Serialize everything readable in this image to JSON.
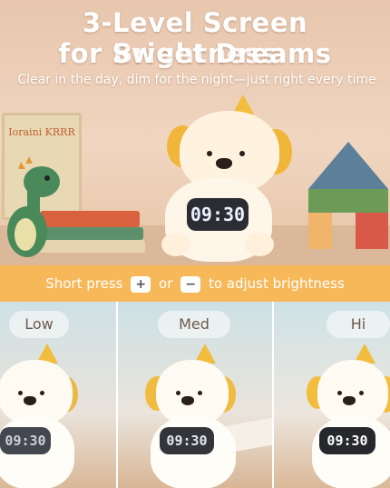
{
  "headline": {
    "line1": "3-Level Screen Brightness",
    "line2": "for Sweet Dreams",
    "subtitle": "Clear in the day, dim for the night—just right every time"
  },
  "clock": {
    "time": "09:30"
  },
  "instruction": {
    "prefix": "Short press",
    "plus_key": "+",
    "middle": "or",
    "minus_key": "−",
    "suffix": "to adjust brightness"
  },
  "levels": [
    {
      "label": "Low",
      "time": "09:30",
      "brightness": 0.3
    },
    {
      "label": "Med",
      "time": "09:30",
      "brightness": 0.65
    },
    {
      "label": "Hi",
      "time": "09:30",
      "brightness": 1.0
    }
  ],
  "book_cover": {
    "title": "Ioraini KRRR"
  },
  "colors": {
    "accent_bar": "#f7b85a",
    "ear_yellow": "#f0b63a",
    "screen_bg": "#2b2d33",
    "heading_text": "#ffffff"
  },
  "icons": {
    "plus": "plus-key-icon",
    "minus": "minus-key-icon"
  }
}
